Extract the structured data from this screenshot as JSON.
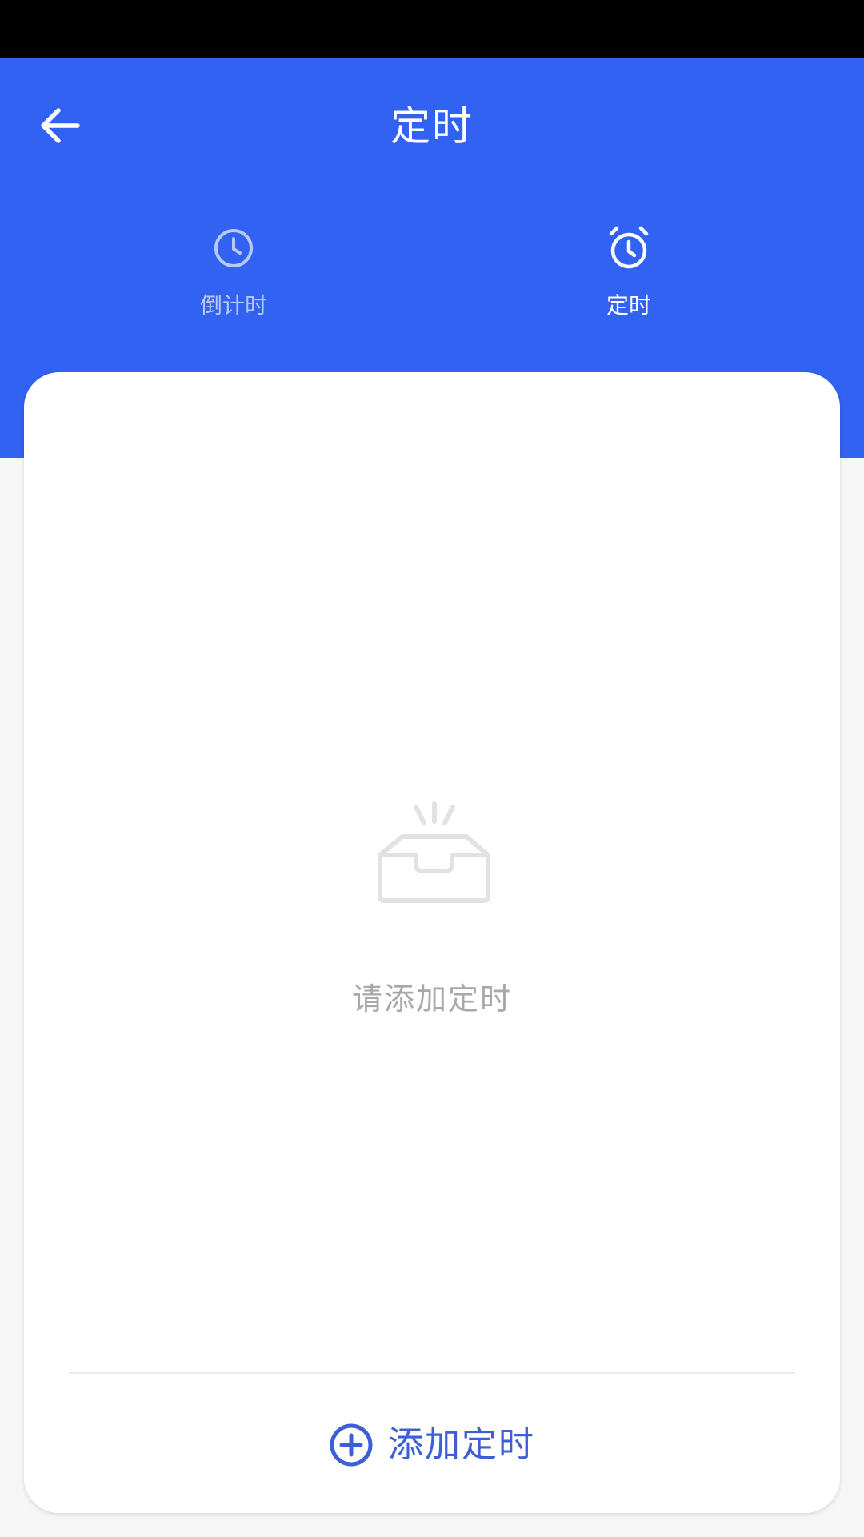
{
  "header": {
    "title": "定时",
    "back_icon": "arrow-left-icon"
  },
  "tabs": [
    {
      "label": "倒计时",
      "icon": "clock-icon",
      "active": false
    },
    {
      "label": "定时",
      "icon": "alarm-clock-icon",
      "active": true
    }
  ],
  "empty_state": {
    "icon": "empty-inbox-icon",
    "text": "请添加定时"
  },
  "footer": {
    "add_label": "添加定时",
    "add_icon": "plus-circle-icon"
  },
  "colors": {
    "primary": "#3262f1",
    "accent": "#3d5fd6",
    "muted_text": "#a8a8a8",
    "inactive_tab": "#b8c8f8"
  }
}
